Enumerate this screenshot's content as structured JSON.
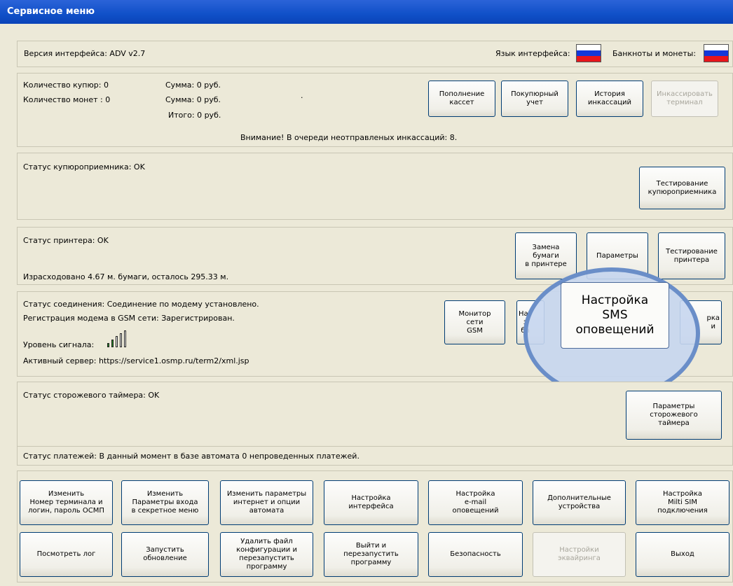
{
  "window": {
    "title": "Сервисное меню"
  },
  "header": {
    "version": "Версия интерфейса: ADV v2.7",
    "language_label": "Язык интерфейса:",
    "money_label": "Банкноты и монеты:"
  },
  "cash": {
    "bills_count": "Количество купюр: 0",
    "coins_count": "Количество монет : 0",
    "sum1": "Сумма: 0 руб.",
    "sum2": "Сумма: 0 руб.",
    "total": "Итого: 0 руб.",
    "dot": ".",
    "warning": "Внимание! В очереди неотправленых инкассаций: 8.",
    "buttons": {
      "refill": "Пополнение\nкассет",
      "bill_account": "Покупюрный\nучет",
      "history": "История\nинкассаций",
      "collect": "Инкассировать\nтерминал"
    }
  },
  "validator": {
    "status": "Статус купюроприемника: OK",
    "test_button": "Тестирование\nкупюроприемника"
  },
  "printer": {
    "status": "Статус принтера: OK",
    "paper_usage": "Израсходовано 4.67 м. бумаги, осталось 295.33 м.",
    "replace_button": "Замена\nбумаги\nв принтере",
    "params_button": "Параметры",
    "test_button": "Тестирование\nпринтера"
  },
  "connection": {
    "status": "Статус соединения: Соединение по модему установлено.",
    "registration": "Регистрация модема в GSM сети: Зарегистрирован.",
    "signal_label": "Уровень сигнала:",
    "signal_level": 0.4,
    "server": "Активный сервер: https://service1.osmp.ru/term2/xml.jsp",
    "gsm_monitor_button": "Монитор\nсети\nGSM",
    "partial_button_1": "Нас\nз\nба",
    "partial_button_2": "рка\nи"
  },
  "sms_callout": {
    "label": "Настройка\nSMS\nоповещений"
  },
  "watchdog": {
    "status": "Статус сторожевого таймера: OK",
    "params_button": "Параметры\nсторожевого\nтаймера"
  },
  "payments": {
    "status": "Статус платежей: В данный момент в базе автомата 0 непроведенных платежей."
  },
  "bottom_row1": [
    "Изменить\nНомер терминала и\nлогин, пароль ОСМП",
    "Изменить\nПараметры входа\nв секретное меню",
    "Изменить параметры\nинтернет и опции\nавтомата",
    "Настройка\nинтерфейса",
    "Настройка\ne-mail\nоповещений",
    "Дополнительные\nустройства",
    "Настройка\nMilti SIM\nподключения"
  ],
  "bottom_row2": [
    "Посмотреть лог",
    "Запустить\nобновление",
    "Удалить файл\nконфигурации и\nперезапустить\nпрограмму",
    "Выйти и\nперезапустить\nпрограмму",
    "Безопасность",
    "Настройки\nэквайринга",
    "Выход"
  ],
  "colors": {
    "accent": "#0a43b8",
    "button_border": "#003c74",
    "callout": "#6a8ec8"
  }
}
